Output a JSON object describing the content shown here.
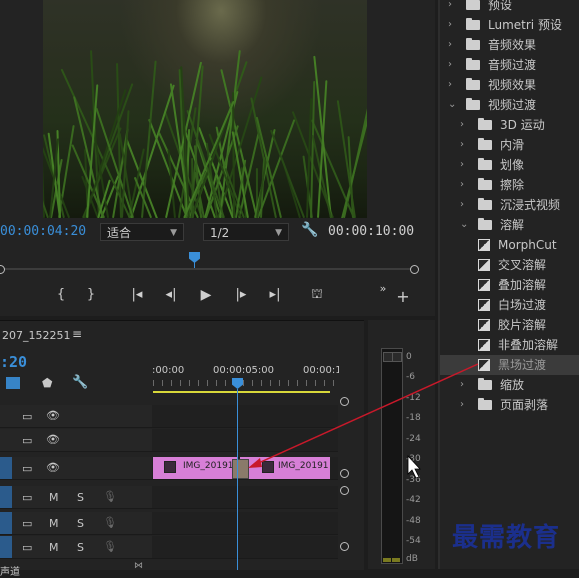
{
  "monitor": {
    "timecode_current": "00:00:04:20",
    "fit_select": "适合",
    "resolution_select": "1/2",
    "timecode_duration": "00:00:10:00"
  },
  "timeline": {
    "sequence_name": "207_152251",
    "menu_glyph": "≡",
    "timecode": ":20",
    "ruler_labels": [
      ":00:00",
      "00:00:05:00",
      "00:00:1("
    ],
    "clip_left_name": "IMG_20191",
    "clip_right_name": "IMG_20191",
    "audio_m": "M",
    "audio_s": "S",
    "bottom_label": "声道"
  },
  "meter": {
    "db_labels": [
      "0",
      "-6",
      "-12",
      "-18",
      "-24",
      "-30",
      "-36",
      "-42",
      "-48",
      "-54",
      "dB"
    ]
  },
  "effects": {
    "items": [
      {
        "label": "预设",
        "level": 0,
        "type": "folder",
        "open": false
      },
      {
        "label": "Lumetri 预设",
        "level": 0,
        "type": "folder",
        "open": false
      },
      {
        "label": "音频效果",
        "level": 0,
        "type": "folder",
        "open": false
      },
      {
        "label": "音频过渡",
        "level": 0,
        "type": "folder",
        "open": false
      },
      {
        "label": "视频效果",
        "level": 0,
        "type": "folder",
        "open": false
      },
      {
        "label": "视频过渡",
        "level": 0,
        "type": "folder",
        "open": true
      },
      {
        "label": "3D 运动",
        "level": 1,
        "type": "folder",
        "open": false
      },
      {
        "label": "内滑",
        "level": 1,
        "type": "folder",
        "open": false
      },
      {
        "label": "划像",
        "level": 1,
        "type": "folder",
        "open": false
      },
      {
        "label": "擦除",
        "level": 1,
        "type": "folder",
        "open": false
      },
      {
        "label": "沉浸式视频",
        "level": 1,
        "type": "folder",
        "open": false
      },
      {
        "label": "溶解",
        "level": 1,
        "type": "folder",
        "open": true
      },
      {
        "label": "MorphCut",
        "level": 2,
        "type": "effect"
      },
      {
        "label": "交叉溶解",
        "level": 2,
        "type": "effect"
      },
      {
        "label": "叠加溶解",
        "level": 2,
        "type": "effect"
      },
      {
        "label": "白场过渡",
        "level": 2,
        "type": "effect"
      },
      {
        "label": "胶片溶解",
        "level": 2,
        "type": "effect"
      },
      {
        "label": "非叠加溶解",
        "level": 2,
        "type": "effect"
      },
      {
        "label": "黑场过渡",
        "level": 2,
        "type": "effect",
        "selected": true
      },
      {
        "label": "缩放",
        "level": 1,
        "type": "folder",
        "open": false
      },
      {
        "label": "页面剥落",
        "level": 1,
        "type": "folder",
        "open": false
      }
    ]
  },
  "watermark": "最需教育",
  "colors": {
    "accent_blue": "#3a8fd9",
    "clip_pink": "#d77fd7",
    "arrow_red": "#c8192a"
  }
}
